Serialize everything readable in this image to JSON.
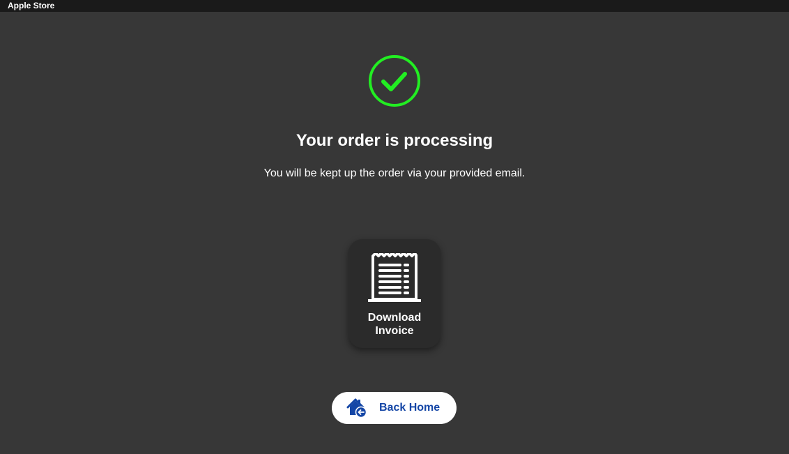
{
  "window": {
    "title": "Apple Store"
  },
  "status": {
    "icon": "check-circle-icon",
    "heading": "Your order is processing",
    "message": "You will be kept up the order via your provided email."
  },
  "invoice": {
    "icon": "receipt-icon",
    "label_line1": "Download",
    "label_line2": "Invoice"
  },
  "back_home": {
    "icon": "home-back-icon",
    "label": "Back Home"
  },
  "colors": {
    "background": "#373737",
    "titlebar": "#1a1a1a",
    "success": "#22ee22",
    "card": "#2b2b2b",
    "button_text": "#1446a6"
  }
}
